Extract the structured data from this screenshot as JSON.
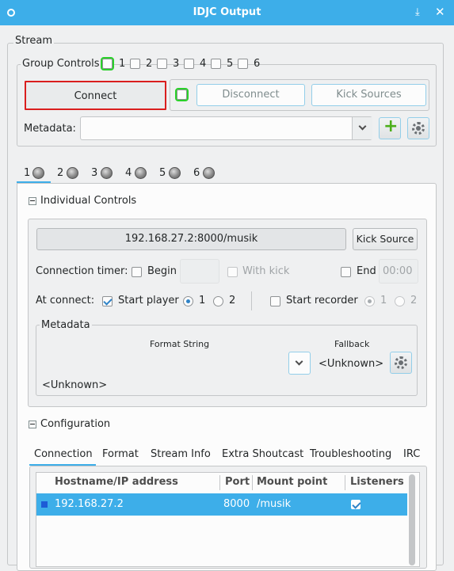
{
  "window": {
    "title": "IDJC Output"
  },
  "stream": {
    "section_label": "Stream",
    "group_controls": {
      "label": "Group Controls",
      "items": [
        "1",
        "2",
        "3",
        "4",
        "5",
        "6"
      ]
    },
    "connect_label": "Connect",
    "disconnect_label": "Disconnect",
    "kick_sources_label": "Kick Sources",
    "metadata_label": "Metadata:",
    "metadata_value": ""
  },
  "stream_tabs": [
    "1",
    "2",
    "3",
    "4",
    "5",
    "6"
  ],
  "individual": {
    "header": "Individual Controls",
    "server_button": "192.168.27.2:8000/musik",
    "kick_source_label": "Kick Source",
    "connection_timer_label": "Connection timer:",
    "begin_label": "Begin",
    "with_kick_label": "With kick",
    "end_label": "End",
    "end_time": "00:00",
    "at_connect_label": "At connect:",
    "start_player_label": "Start player",
    "start_player_checked": true,
    "player_options": [
      "1",
      "2"
    ],
    "start_recorder_label": "Start recorder",
    "start_recorder_checked": false,
    "recorder_options": [
      "1",
      "2"
    ],
    "metadata": {
      "header": "Metadata",
      "format_string_label": "Format String",
      "fallback_label": "Fallback",
      "fallback_value": "<Unknown>",
      "preview": "<Unknown>"
    }
  },
  "configuration": {
    "header": "Configuration",
    "tabs": [
      "Connection",
      "Format",
      "Stream Info",
      "Extra Shoutcast",
      "Troubleshooting",
      "IRC"
    ],
    "active_tab": "Connection",
    "table": {
      "columns": [
        "Hostname/IP address",
        "Port",
        "Mount point",
        "Listeners"
      ],
      "rows": [
        {
          "host": "192.168.27.2",
          "port": "8000",
          "mount": "/musik",
          "listeners_checked": true
        }
      ]
    }
  },
  "colors": {
    "accent": "#3daee9",
    "selection": "#3daee9",
    "connect_outline": "#da1e1e",
    "highlight": "#2ad12a"
  }
}
